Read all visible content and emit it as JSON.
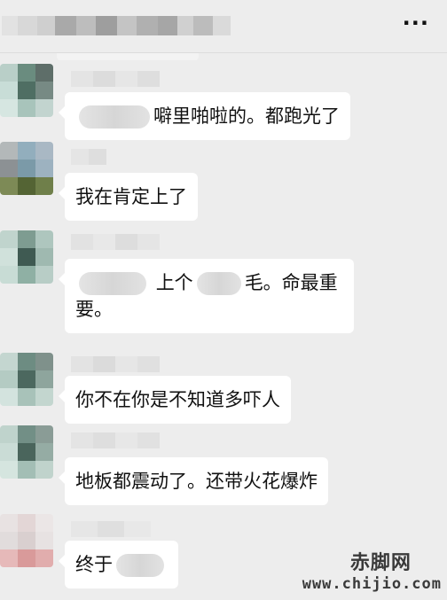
{
  "header": {
    "title_blurred": true,
    "more_label": "···"
  },
  "messages": [
    {
      "text": "噼里啪啦的。都跑光了"
    },
    {
      "text": "我在肯定上了"
    },
    {
      "text_a": "上个",
      "text_b": "毛。命最重",
      "text_c": "要。"
    },
    {
      "text": "你不在你是不知道多吓人"
    },
    {
      "text": "地板都震动了。还带火花爆炸"
    },
    {
      "text": "终于"
    }
  ],
  "watermark": {
    "cn": "赤脚网",
    "en": "www.chijio.com"
  },
  "colors": {
    "background": "#ededed",
    "bubble": "#ffffff"
  }
}
